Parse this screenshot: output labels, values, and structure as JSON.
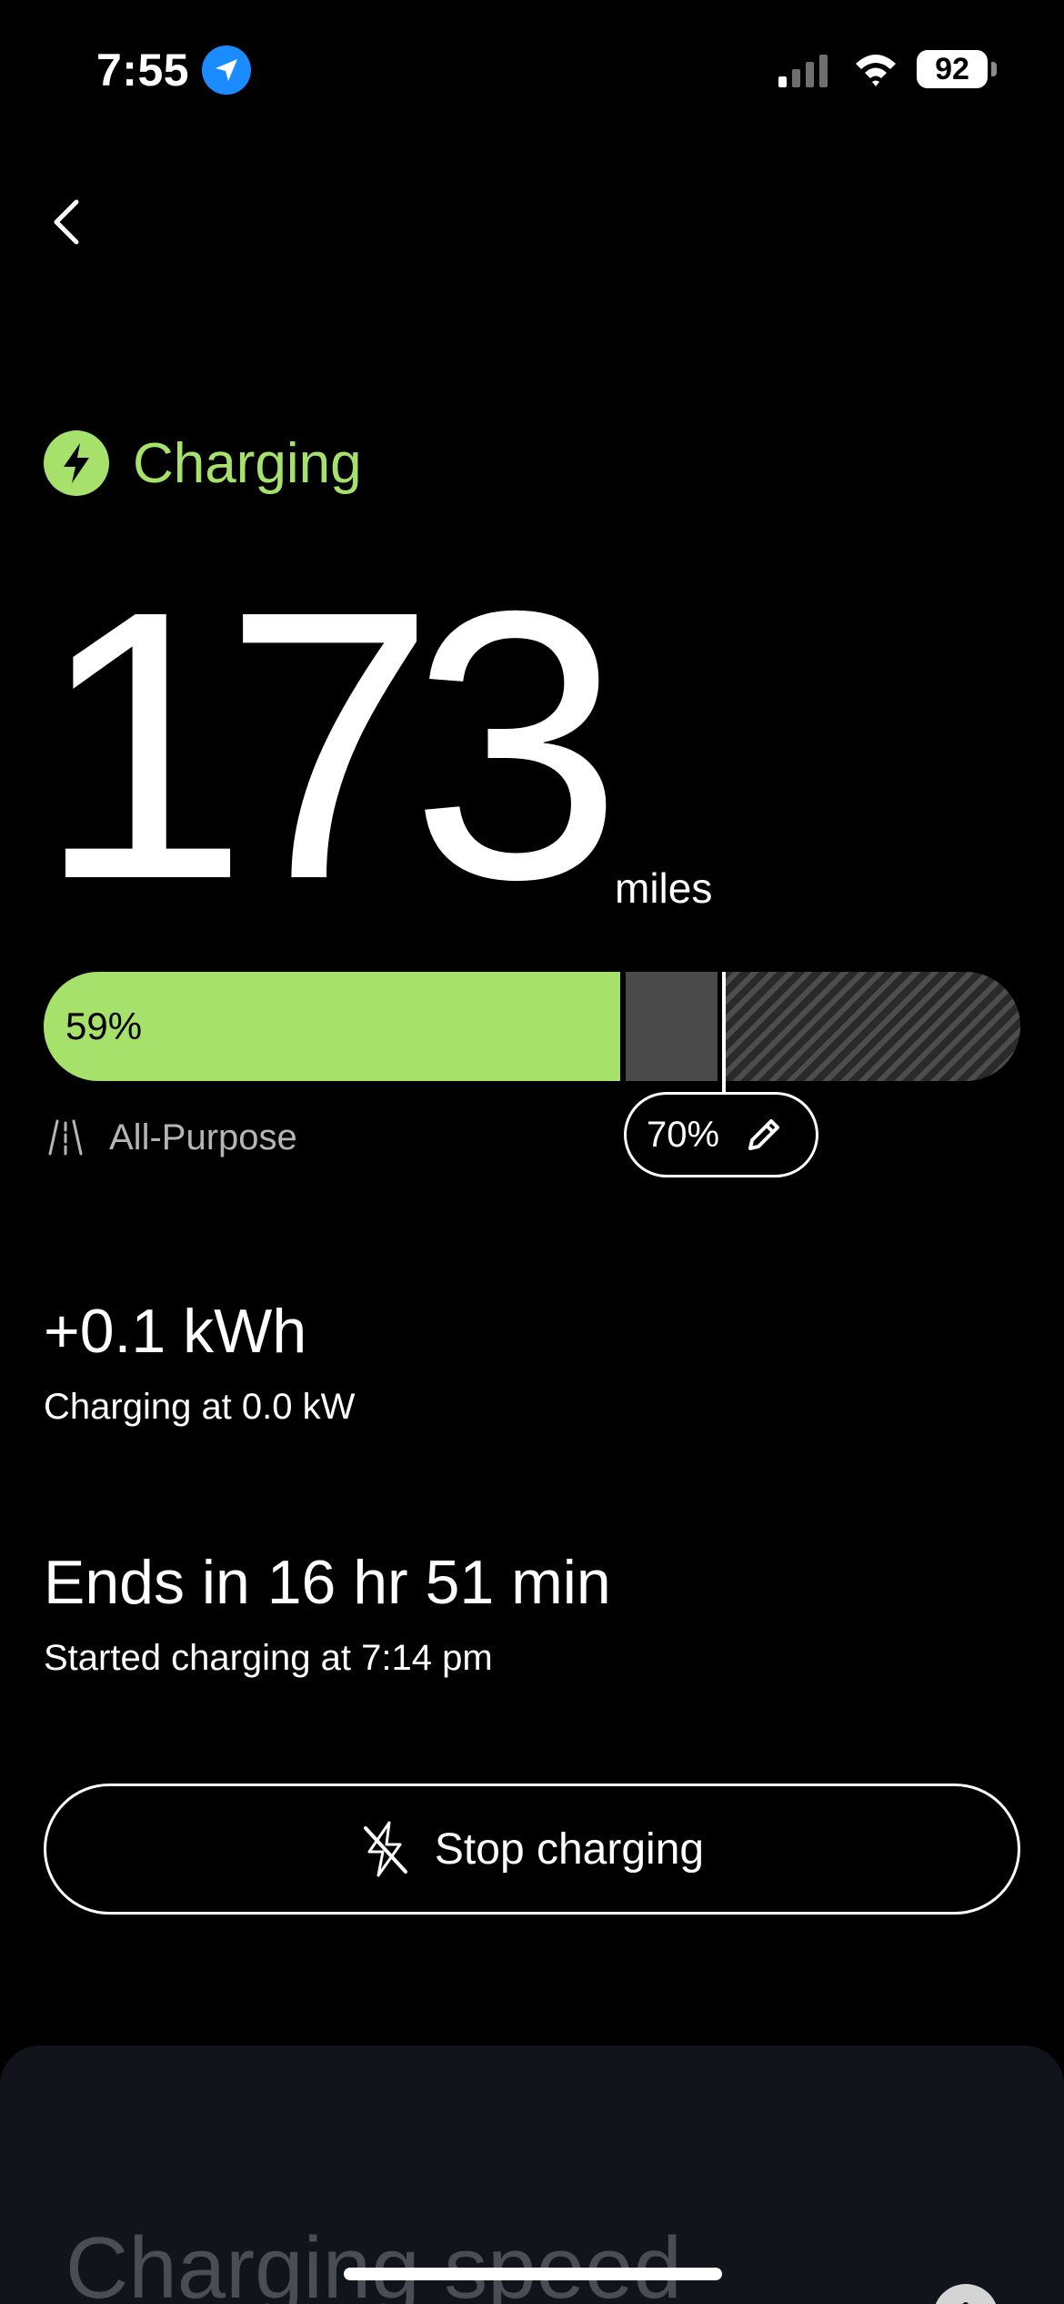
{
  "status_bar": {
    "time": "7:55",
    "battery_level": "92",
    "icons": [
      "location-arrow-icon",
      "cellular-signal-icon",
      "wifi-icon",
      "battery-icon"
    ]
  },
  "nav": {
    "back_icon": "chevron-left-icon"
  },
  "charging": {
    "status_label": "Charging",
    "status_icon": "lightning-bolt-icon",
    "range_value": "173",
    "range_unit": "miles",
    "battery_percent": 59,
    "battery_percent_label": "59%",
    "pending_until_percent": 69,
    "charge_limit_percent": 70,
    "charge_limit_label": "70%",
    "mode_icon": "road-icon",
    "mode_label": "All-Purpose",
    "energy_added": "+0.1 kWh",
    "charge_rate": "Charging at 0.0 kW",
    "time_remaining": "Ends in 16 hr 51 min",
    "start_time": "Started charging at 7:14 pm",
    "stop_button_label": "Stop charging",
    "stop_icon": "no-charging-bolt-icon",
    "edit_icon": "pencil-icon"
  },
  "speed_card": {
    "title": "Charging speed",
    "info_icon": "info-icon",
    "info_glyph": "i"
  },
  "colors": {
    "background": "#000000",
    "accent": "#a6e26b",
    "pending": "#4a4a4a",
    "card": "#11141a"
  }
}
